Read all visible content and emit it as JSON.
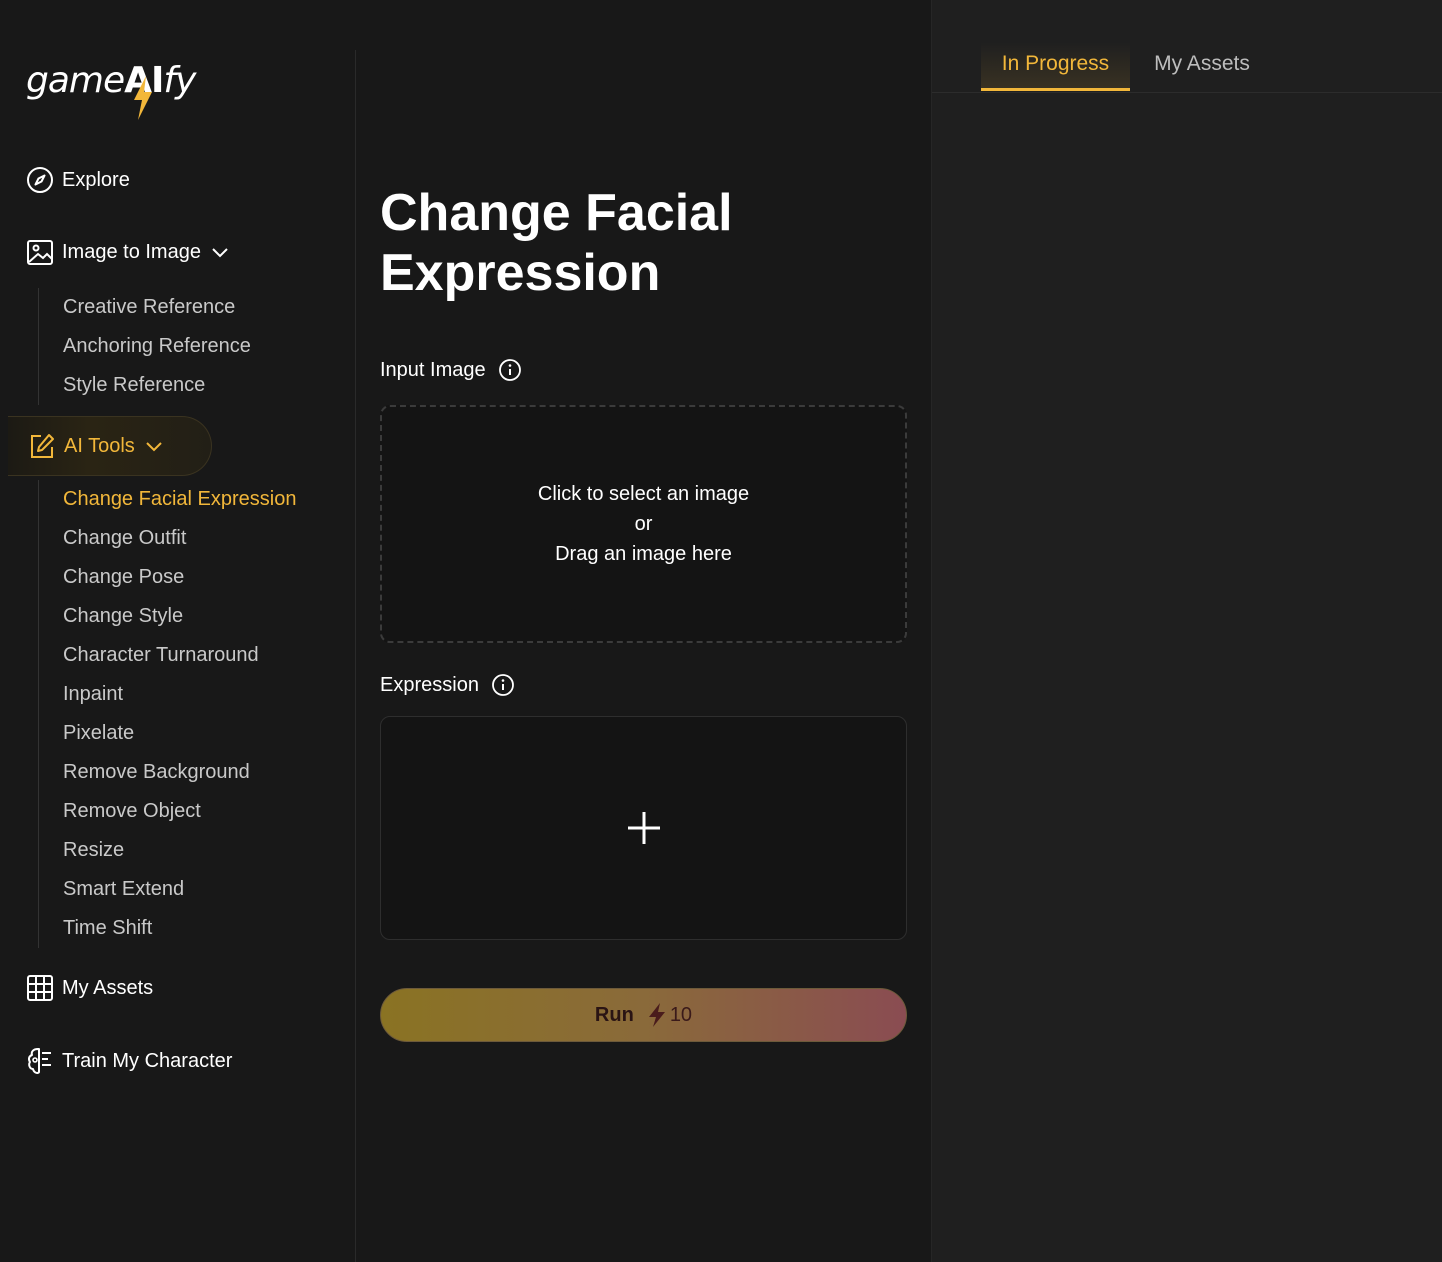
{
  "app": {
    "logo_left": "game",
    "logo_ai": "AI",
    "logo_right": "fy"
  },
  "sidebar": {
    "explore": {
      "label": "Explore",
      "icon": "compass-icon"
    },
    "image_to_image": {
      "label": "Image to Image",
      "icon": "image-icon",
      "items": [
        "Creative Reference",
        "Anchoring Reference",
        "Style Reference"
      ]
    },
    "ai_tools": {
      "label": "AI Tools",
      "icon": "edit-icon",
      "items": [
        "Change Facial Expression",
        "Change Outfit",
        "Change Pose",
        "Change Style",
        "Character Turnaround",
        "Inpaint",
        "Pixelate",
        "Remove Background",
        "Remove Object",
        "Resize",
        "Smart Extend",
        "Time Shift"
      ],
      "active_item": "Change Facial Expression"
    },
    "my_assets": {
      "label": "My Assets",
      "icon": "grid-icon"
    },
    "train_character": {
      "label": "Train My Character",
      "icon": "brain-icon"
    }
  },
  "main": {
    "title": "Change Facial Expression",
    "input_image": {
      "label": "Input Image",
      "line1": "Click to select an image",
      "line2": "or",
      "line3": "Drag an image here"
    },
    "expression": {
      "label": "Expression"
    },
    "run": {
      "label": "Run",
      "cost": "10"
    }
  },
  "right_panel": {
    "tabs": [
      "In Progress",
      "My Assets"
    ],
    "active_tab": "In Progress"
  },
  "colors": {
    "accent": "#f2b73a",
    "background": "#181818",
    "panel": "#1f1f1f"
  }
}
